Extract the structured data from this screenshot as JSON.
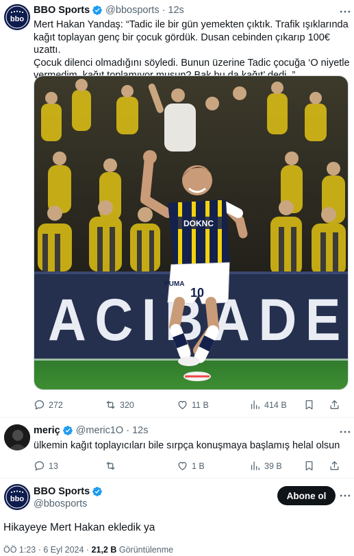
{
  "post1": {
    "name": "BBO Sports",
    "handle": "@bbosports",
    "time": "12s",
    "line1": "Mert Hakan Yandaş: “Tadic ile bir gün yemekten çıktık. Trafik ışıklarında",
    "line2": "kağıt toplayan genç bir çocuk gördük. Dusan cebinden çıkarıp 100€ uzattı.",
    "line3": "Çocuk dilenci olmadığını söyledi. Bunun üzerine Tadic çocuğa ‘O niyetle",
    "line4": "vermedim, kağıt toplamıyor musun? Bak bu da kağıt’ dedi..”",
    "media": {
      "board_text": "ACIBADE",
      "shirt_sponsor": "DOKNC",
      "shirt_number": "10",
      "shorts_brand": "PUMA"
    },
    "stats": {
      "replies": "272",
      "retweets": "320",
      "likes": "11 B",
      "views": "414 B"
    }
  },
  "post2": {
    "name": "meriç",
    "handle": "@meric1O",
    "time": "12s",
    "text": "ülkemin kağıt toplayıcıları bile sırpça konuşmaya başlamış helal olsun",
    "stats": {
      "replies": "13",
      "retweets": "",
      "likes": "1 B",
      "views": "39 B"
    }
  },
  "post3": {
    "name": "BBO Sports",
    "handle": "@bbosports",
    "follow_label": "Abone ol",
    "text": "Hikayeye Mert Hakan ekledik ya",
    "meta_time": "ÖÖ 1:23 · 6 Eyl 2024 · ",
    "meta_views": "21,2 B",
    "meta_views_label": " Görüntülenme"
  },
  "avatar_logo_text": "bbo",
  "colors": {
    "verified": "#1d9bf0",
    "text_primary": "#0f1419",
    "text_secondary": "#536471",
    "kit_navy": "#14214d",
    "kit_yellow": "#f2d20d"
  }
}
